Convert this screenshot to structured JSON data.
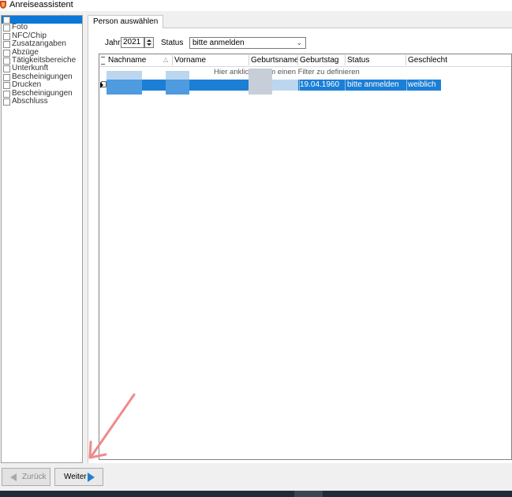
{
  "window": {
    "title": "Anreiseassistent"
  },
  "steps": [
    {
      "label": "Person auswählen",
      "active": true
    },
    {
      "label": "Foto"
    },
    {
      "label": "NFC/Chip"
    },
    {
      "label": "Zusatzangaben"
    },
    {
      "label": "Abzüge"
    },
    {
      "label": "Tätigkeitsbereiche"
    },
    {
      "label": "Unterkunft"
    },
    {
      "label": "Bescheinigungen"
    },
    {
      "label": "Drucken"
    },
    {
      "label": "Bescheinigungen"
    },
    {
      "label": "Abschluss"
    }
  ],
  "tab": {
    "label": "Person auswählen"
  },
  "filters": {
    "year_label": "Jahr",
    "year_value": "2021",
    "status_label": "Status",
    "status_value": "bitte anmelden"
  },
  "grid": {
    "columns": [
      "Nachname",
      "Vorname",
      "Geburtsname",
      "Geburtstag",
      "Status",
      "Geschlecht"
    ],
    "filter_hint": "Hier anklicken, um einen Filter zu definieren",
    "rows": [
      {
        "nachname": "",
        "vorname": "",
        "geburtsname": "",
        "geburtstag": "19.04.1960",
        "status": "bitte anmelden",
        "geschlecht": "weiblich"
      }
    ]
  },
  "buttons": {
    "back": "Zurück",
    "next": "Weiter"
  },
  "colors": {
    "accent": "#1b7fd6",
    "annotation_arrow": "#f08080"
  }
}
